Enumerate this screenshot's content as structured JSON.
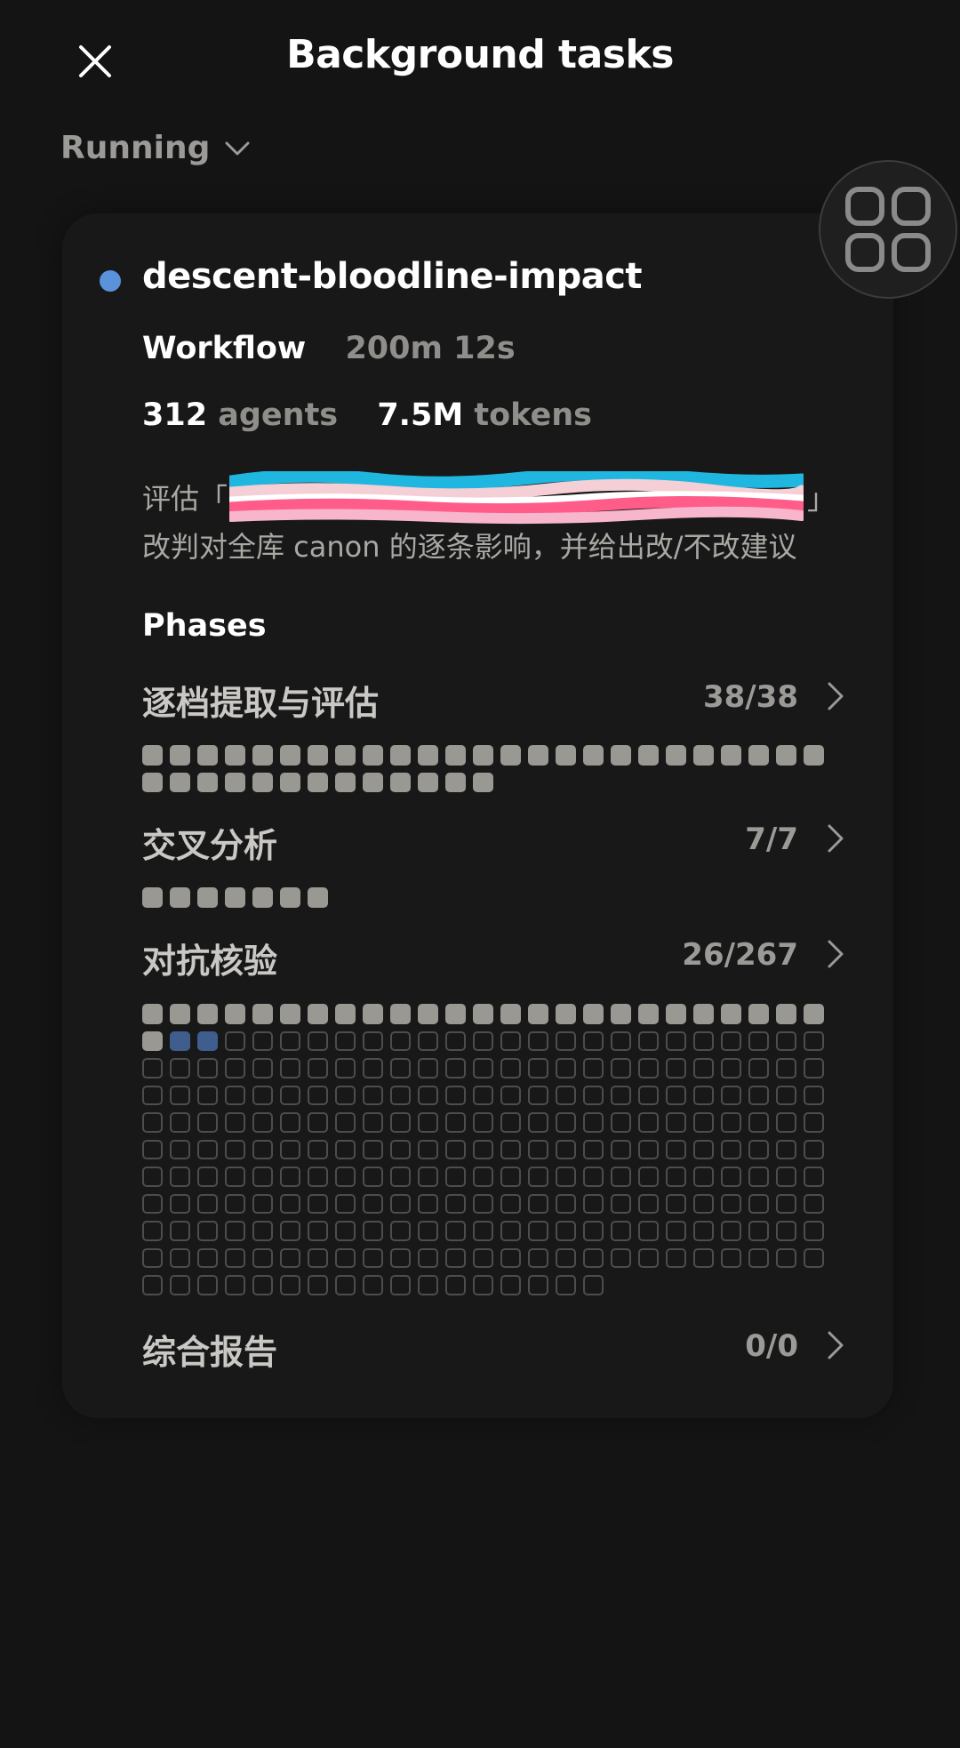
{
  "header": {
    "title": "Background tasks"
  },
  "filter": {
    "label": "Running"
  },
  "task": {
    "name": "descent-bloodline-impact",
    "type_label": "Workflow",
    "duration": "200m 12s",
    "agents_count": "312",
    "agents_label": "agents",
    "tokens_count": "7.5M",
    "tokens_label": "tokens",
    "description_line1_start": "评估「",
    "description_line1_end": "」",
    "description_line2": "改判对全库 canon 的逐条影响，并给出改/不改建议",
    "redaction_colors": [
      "#1fb6e0",
      "#f5cfd6",
      "#ffffff",
      "#ff5c8a",
      "#f7b6cc"
    ]
  },
  "phases": {
    "heading": "Phases",
    "items": [
      {
        "name": "逐档提取与评估",
        "count": "38/38",
        "done": 38,
        "active": 0,
        "pending": 0
      },
      {
        "name": "交叉分析",
        "count": "7/7",
        "done": 7,
        "active": 0,
        "pending": 0
      },
      {
        "name": "对抗核验",
        "count": "26/267",
        "done": 26,
        "active": 2,
        "pending": 239
      },
      {
        "name": "综合报告",
        "count": "0/0",
        "done": 0,
        "active": 0,
        "pending": 0
      }
    ]
  },
  "colors": {
    "background": "#141414",
    "card": "#181818",
    "status_dot": "#5b92dc",
    "done_square": "#9a9893",
    "active_square": "#3f5d8d"
  }
}
